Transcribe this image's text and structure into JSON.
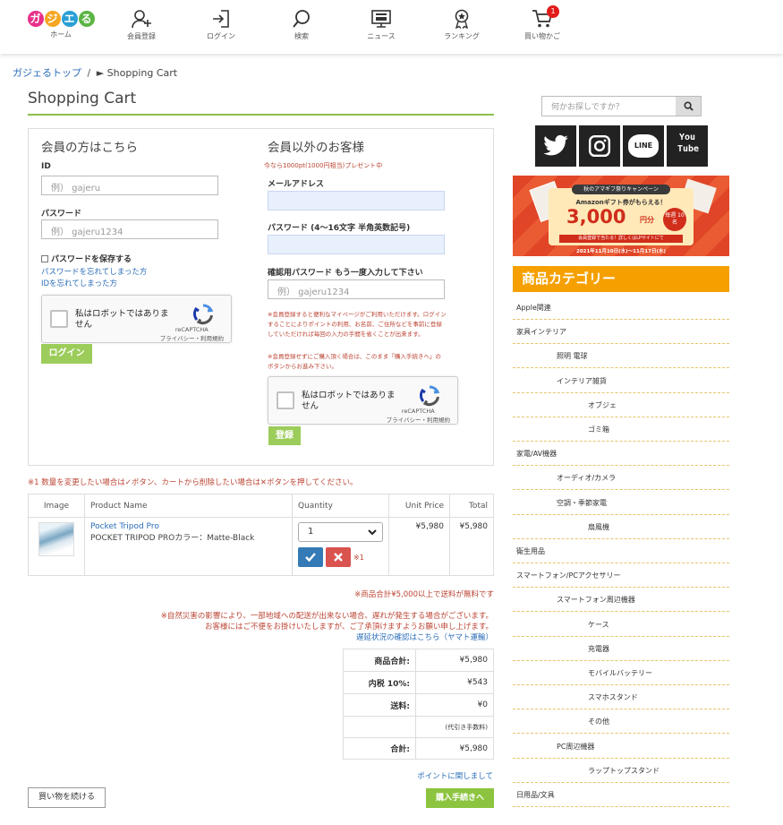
{
  "header": {
    "logo_letters": [
      "ガ",
      "ジ",
      "エ",
      "る"
    ],
    "logo_label": "ホーム",
    "nav": [
      {
        "label": "会員登録",
        "icon": "user-add-icon"
      },
      {
        "label": "ログイン",
        "icon": "login-icon"
      },
      {
        "label": "検索",
        "icon": "search-icon"
      },
      {
        "label": "ニュース",
        "icon": "news-icon"
      },
      {
        "label": "ランキング",
        "icon": "ranking-icon"
      },
      {
        "label": "買い物かご",
        "icon": "cart-icon",
        "badge": "1"
      }
    ]
  },
  "breadcrumb": {
    "home": "ガジェるトップ",
    "sep": "/",
    "current": "► Shopping Cart"
  },
  "page_title": "Shopping Cart",
  "member": {
    "heading": "会員の方はこちら",
    "id_label": "ID",
    "id_placeholder": "例） gajeru",
    "pw_label": "パスワード",
    "pw_placeholder": "例） gajeru1234",
    "save_pw": "パスワードを保存する",
    "forgot_pw": "パスワードを忘れてしまった方",
    "forgot_id": "IDを忘れてしまった方",
    "login_btn": "ログイン"
  },
  "guest": {
    "heading": "会員以外のお客様",
    "promo": "今なら1000pt(1000円相当)プレゼント中",
    "email_label": "メールアドレス",
    "pw_label": "パスワード (4〜16文字 半角英数記号)",
    "confirm_label": "確認用パスワード もう一度入力して下さい",
    "confirm_placeholder": "例） gajeru1234",
    "note1": "※会員登録すると便利なマイページがご利用いただけます。ログインすることによりポイントの利用、お名前、ご住所などを事前に登録していただければ毎回の入力の手間を省くことが出来ます。",
    "note2": "※会員登録せずにご購入頂く場合は、このまま「購入手続きへ」のボタンからお進み下さい。",
    "register_btn": "登録"
  },
  "captcha": {
    "text": "私はロボットではありません",
    "brand": "reCAPTCHA",
    "links": "プライバシー・利用規約"
  },
  "cart_note": "※1 数量を変更したい場合は✓ボタン、カートから削除したい場合は✕ボタンを押してください。",
  "cart": {
    "headers": [
      "Image",
      "Product Name",
      "Quantity",
      "Unit Price",
      "Total"
    ],
    "items": [
      {
        "name": "Pocket Tripod Pro",
        "variant": "POCKET TRIPOD PROカラー：Matte-Black",
        "qty": "1",
        "unit_price": "¥5,980",
        "total": "¥5,980",
        "note": "※1"
      }
    ]
  },
  "shipping_note": "※商品合計¥5,000以上で送料が無料です",
  "disaster_note_1": "※自然災害の影響により、一部地域への配送が出来ない場合、遅れが発生する場合がございます。",
  "disaster_note_2": "お客様にはご不便をお掛けいたしますが、ご了承頂けますようお願い申し上げます。",
  "delay_link": "遅延状況の確認はこちら（ヤマト運輸）",
  "summary": [
    {
      "label": "商品合計:",
      "value": "¥5,980"
    },
    {
      "label": "内税 10%:",
      "value": "¥543"
    },
    {
      "label": "送料:",
      "value": "¥0"
    },
    {
      "label": "",
      "value": "(代引き手数料)"
    },
    {
      "label": "合計:",
      "value": "¥5,980"
    }
  ],
  "points_link": "ポイントに関しまして",
  "continue_btn": "買い物を続ける",
  "checkout_btn": "購入手続きへ",
  "sidebar": {
    "search_placeholder": "何かお探しですか？",
    "sns": [
      {
        "name": "twitter",
        "icon": "twitter-icon"
      },
      {
        "name": "instagram",
        "icon": "instagram-icon",
        "label": "◎"
      },
      {
        "name": "line",
        "icon": "line-icon",
        "label": "LINE"
      },
      {
        "name": "youtube",
        "icon": "youtube-icon",
        "label": "You Tube"
      }
    ],
    "banner": {
      "top": "秋のアマギフ祭りキャンペーン",
      "mid": "Amazonギフト券がもらえる！",
      "amount": "3,000",
      "unit": "円分",
      "winners": "毎週 10名",
      "sub": "会員登録で当たる！詳しくはLPサイトにて",
      "date": "2021年11月10日(水)〜11月17日(水)"
    },
    "cat_title": "商品カテゴリー",
    "categories": [
      {
        "label": "Apple関連",
        "level": 0
      },
      {
        "label": "家具インテリア",
        "level": 0
      },
      {
        "label": "照明 電球",
        "level": 1
      },
      {
        "label": "インテリア雑貨",
        "level": 1
      },
      {
        "label": "オブジェ",
        "level": 2
      },
      {
        "label": "ゴミ箱",
        "level": 2
      },
      {
        "label": "家電/AV機器",
        "level": 0
      },
      {
        "label": "オーディオ/カメラ",
        "level": 1
      },
      {
        "label": "空調・季節家電",
        "level": 1
      },
      {
        "label": "扇風機",
        "level": 2
      },
      {
        "label": "衛生用品",
        "level": 0
      },
      {
        "label": "スマートフォン/PCアクセサリー",
        "level": 0
      },
      {
        "label": "スマートフォン周辺機器",
        "level": 1
      },
      {
        "label": "ケース",
        "level": 2
      },
      {
        "label": "充電器",
        "level": 2
      },
      {
        "label": "モバイルバッテリー",
        "level": 2
      },
      {
        "label": "スマホスタンド",
        "level": 2
      },
      {
        "label": "その他",
        "level": 2
      },
      {
        "label": "PC周辺機器",
        "level": 1
      },
      {
        "label": "ラップトップスタンド",
        "level": 2
      },
      {
        "label": "日用品/文具",
        "level": 0
      }
    ]
  },
  "colors": {
    "accent_green": "#8cbf4a",
    "button_green": "#9ccc5a",
    "category_orange": "#f5a000",
    "link_blue": "#2a6db8",
    "note_red": "#b43"
  }
}
